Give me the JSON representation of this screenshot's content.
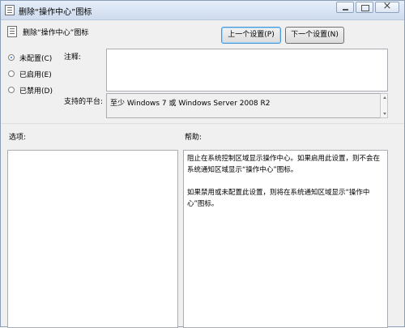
{
  "window": {
    "title": "删除“操作中心”图标",
    "setting_name": "删除“操作中心”图标"
  },
  "nav": {
    "prev_label": "上一个设置(P)",
    "next_label": "下一个设置(N)"
  },
  "state": {
    "options": [
      {
        "label": "未配置(C)",
        "selected": true
      },
      {
        "label": "已启用(E)",
        "selected": false
      },
      {
        "label": "已禁用(D)",
        "selected": false
      }
    ]
  },
  "comment": {
    "label": "注释:",
    "value": ""
  },
  "platform": {
    "label": "支持的平台:",
    "value": "至少 Windows 7 或 Windows Server 2008 R2"
  },
  "options_section": {
    "label": "选项:"
  },
  "help_section": {
    "label": "帮助:",
    "paragraphs": [
      "阻止在系统控制区域显示操作中心。如果启用此设置，则不会在系统通知区域显示“操作中心”图标。",
      "如果禁用或未配置此设置，则将在系统通知区域显示“操作中心”图标。"
    ]
  }
}
